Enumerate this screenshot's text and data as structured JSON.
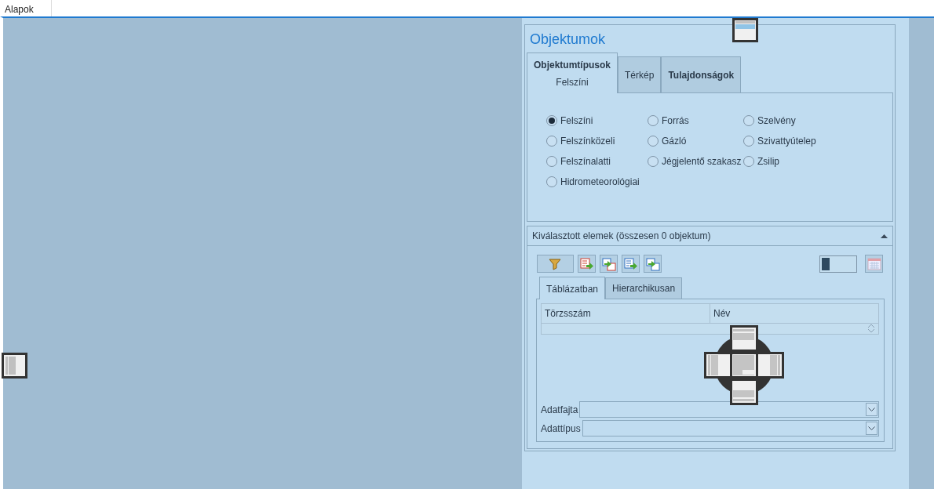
{
  "menu": {
    "title": "Alapok"
  },
  "panel": {
    "title": "Objektumok",
    "tabs": [
      {
        "label": "Objektumtípusok",
        "sublabel": "Felszíni",
        "selected": true,
        "bold": true
      },
      {
        "label": "Térkép",
        "selected": false,
        "bold": false
      },
      {
        "label": "Tulajdonságok",
        "selected": false,
        "bold": true
      }
    ],
    "option_columns": [
      [
        {
          "label": "Felszíni",
          "selected": true
        },
        {
          "label": "Felszínközeli",
          "selected": false
        },
        {
          "label": "Felszínalatti",
          "selected": false
        },
        {
          "label": "Hidrometeorológiai",
          "selected": false
        }
      ],
      [
        {
          "label": "Forrás",
          "selected": false
        },
        {
          "label": "Gázló",
          "selected": false
        },
        {
          "label": "Jégjelentő szakasz",
          "selected": false
        }
      ],
      [
        {
          "label": "Szelvény",
          "selected": false
        },
        {
          "label": "Szivattyútelep",
          "selected": false
        },
        {
          "label": "Zsilip",
          "selected": false
        }
      ]
    ],
    "selection": {
      "title": "Kiválasztott elemek (összesen 0 objektum)",
      "expanded": true,
      "toggle": {
        "on": false
      },
      "subtabs": [
        {
          "label": "Táblázatban",
          "selected": true
        },
        {
          "label": "Hierarchikusan",
          "selected": false
        }
      ],
      "table": {
        "columns": [
          "Törzsszám",
          "Név"
        ]
      },
      "fields": [
        {
          "label": "Adatfajta"
        },
        {
          "label": "Adattípus"
        }
      ]
    }
  }
}
